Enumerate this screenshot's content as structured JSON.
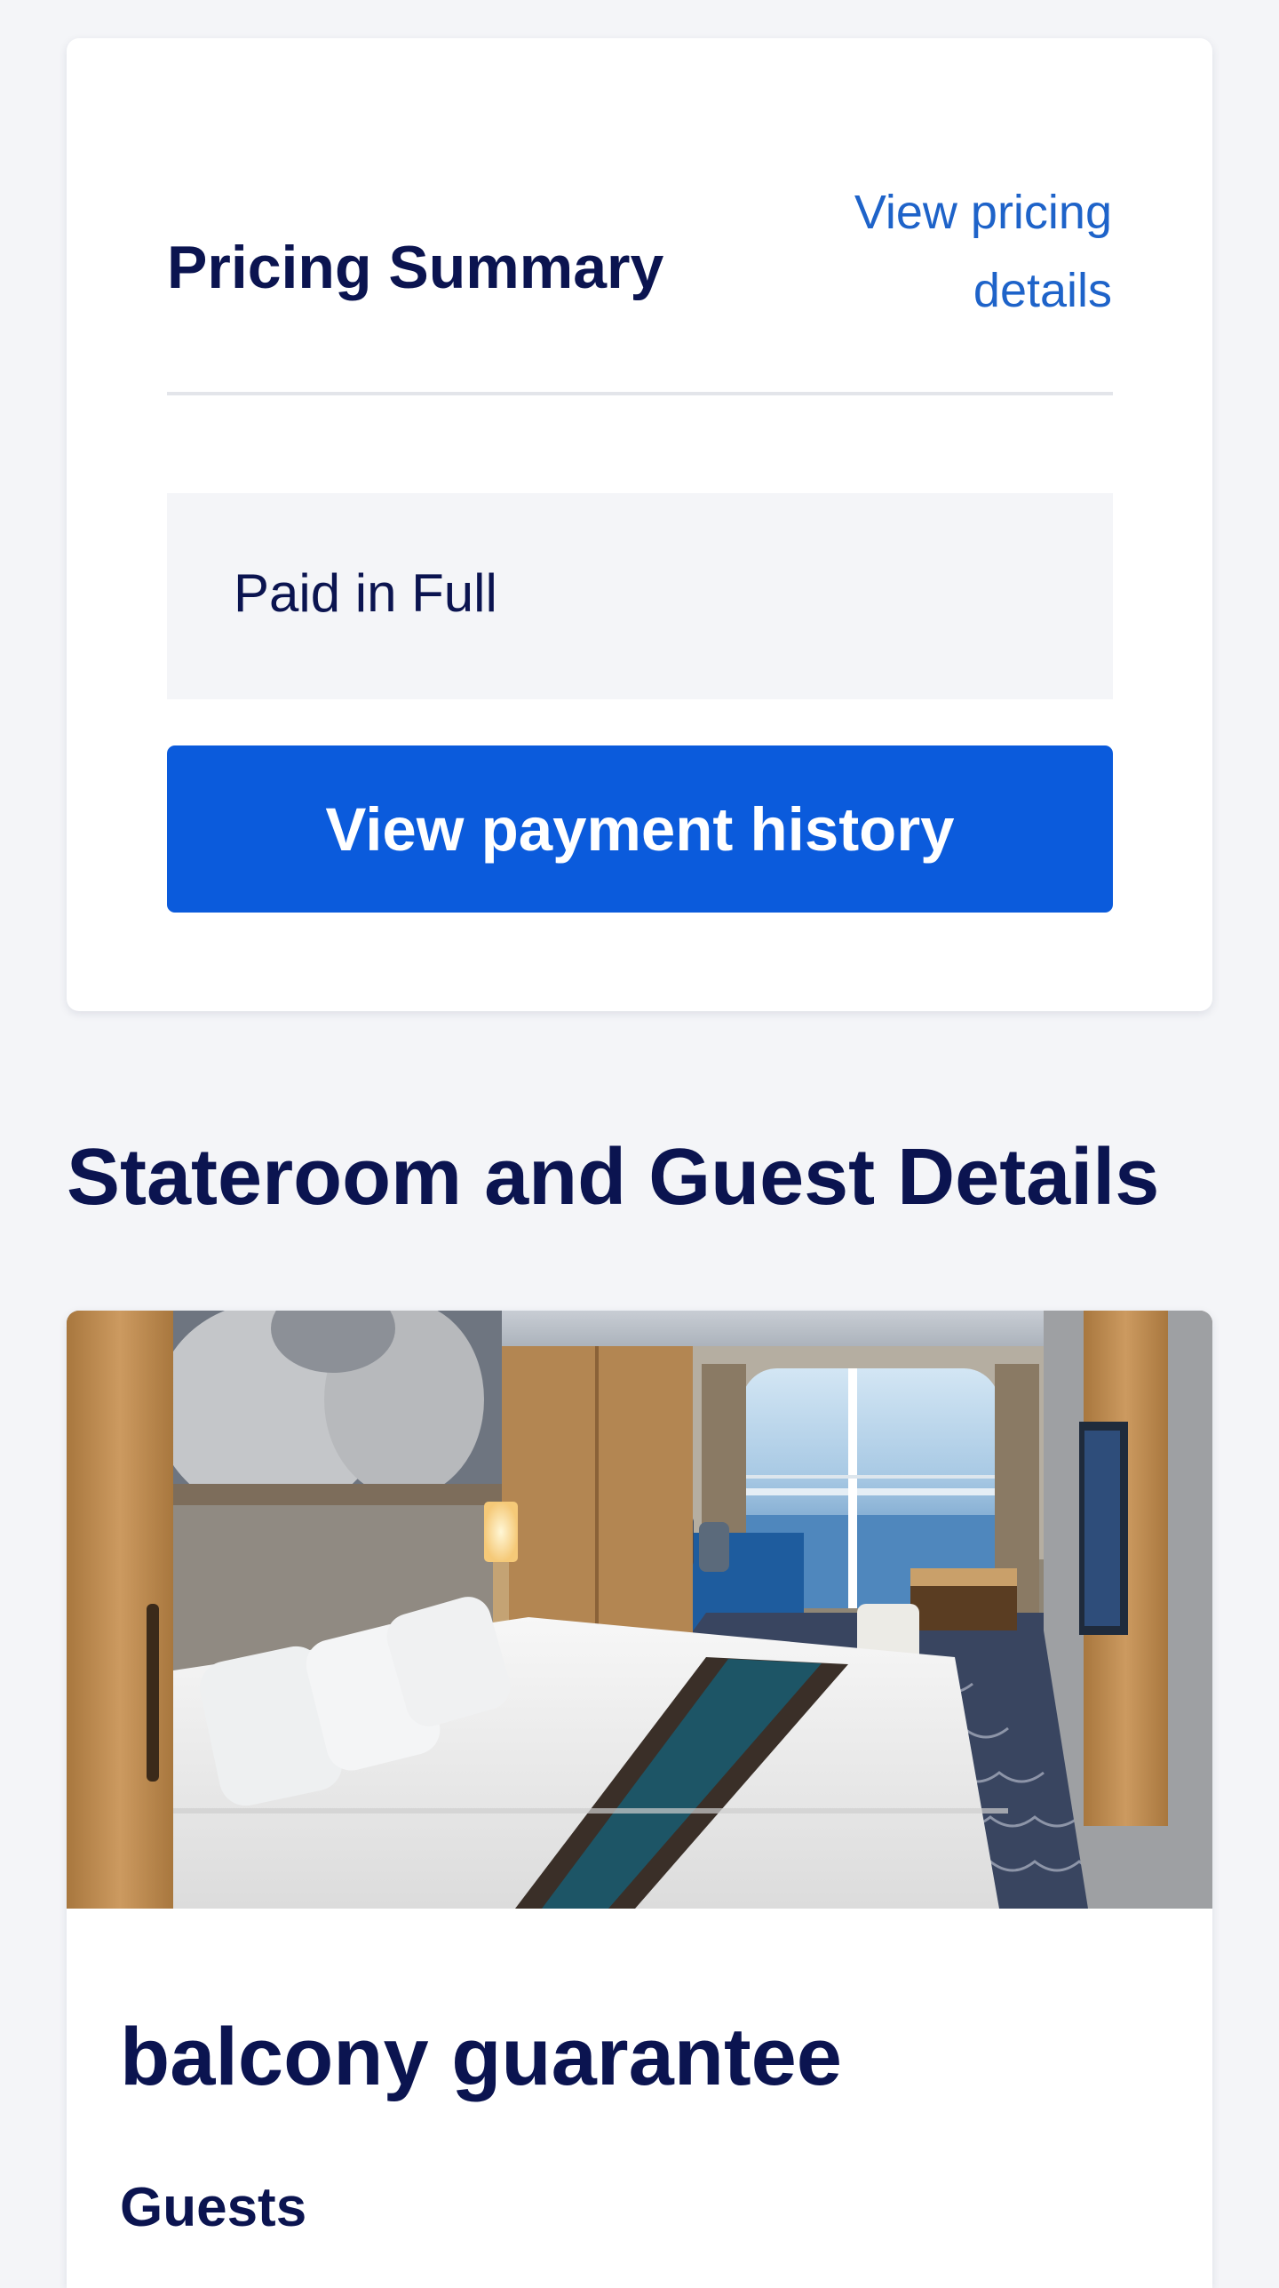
{
  "pricing_summary": {
    "title": "Pricing Summary",
    "details_link": "View pricing details",
    "payment_status": "Paid in Full",
    "payment_history_button": "View payment history"
  },
  "stateroom_section": {
    "title": "Stateroom and Guest Details",
    "room_image": "stateroom-photo",
    "room_name": "balcony guarantee",
    "guests_label": "Guests"
  },
  "colors": {
    "page_background": "#f4f5f8",
    "text_navy": "#0b1450",
    "link_blue": "#1e63c9",
    "button_blue": "#0b5bdc"
  }
}
